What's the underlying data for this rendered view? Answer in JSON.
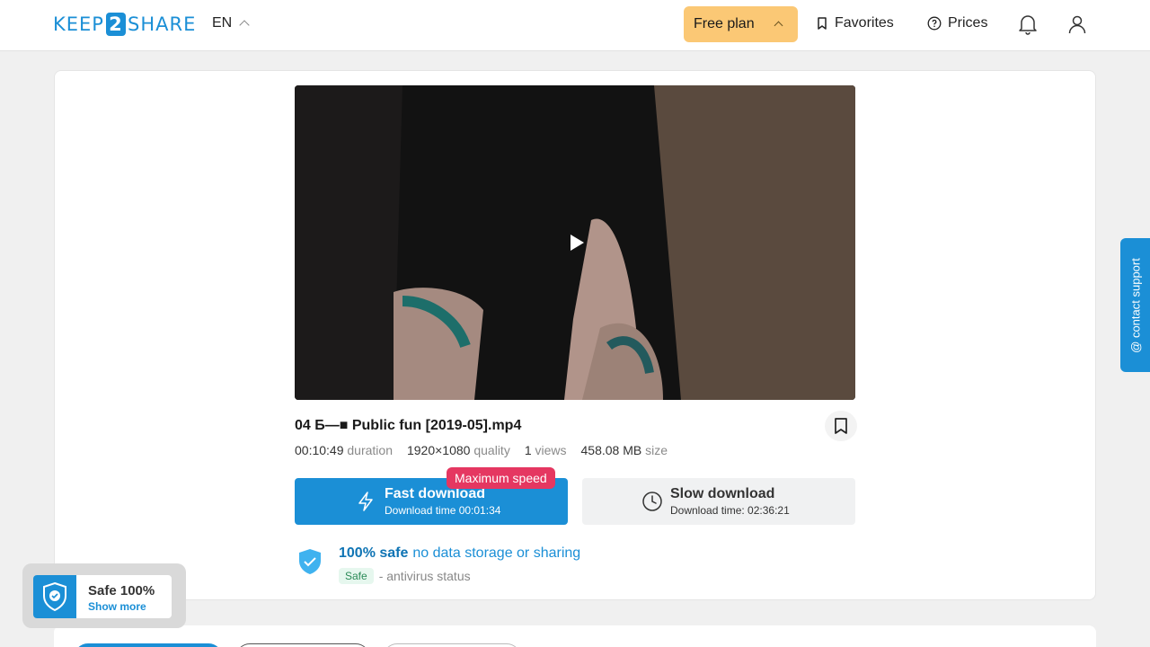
{
  "header": {
    "logo_left": "KEEP",
    "logo_mid": "2",
    "logo_right": "SHARE",
    "language": "EN",
    "plan_label": "Free plan",
    "favorites_label": "Favorites",
    "prices_label": "Prices"
  },
  "file": {
    "title": "04 Б—■ Public fun [2019-05].mp4",
    "duration_value": "00:10:49",
    "duration_label": "duration",
    "quality_value": "1920×1080",
    "quality_label": "quality",
    "views_value": "1",
    "views_label": "views",
    "size_value": "458.08 MB",
    "size_label": "size"
  },
  "downloads": {
    "badge": "Maximum speed",
    "fast_title": "Fast download",
    "fast_subtitle": "Download time 00:01:34",
    "slow_title": "Slow download",
    "slow_subtitle": "Download time: 02:36:21"
  },
  "safety": {
    "bold": "100% safe",
    "rest": "no data storage or sharing",
    "tag": "Safe",
    "status": "- antivirus status"
  },
  "support": {
    "label": "@ contact support"
  },
  "widget": {
    "title": "Safe 100%",
    "link": "Show more"
  },
  "colors": {
    "accent": "#1b8fd6",
    "plan": "#fbc875",
    "badge": "#e53761"
  }
}
